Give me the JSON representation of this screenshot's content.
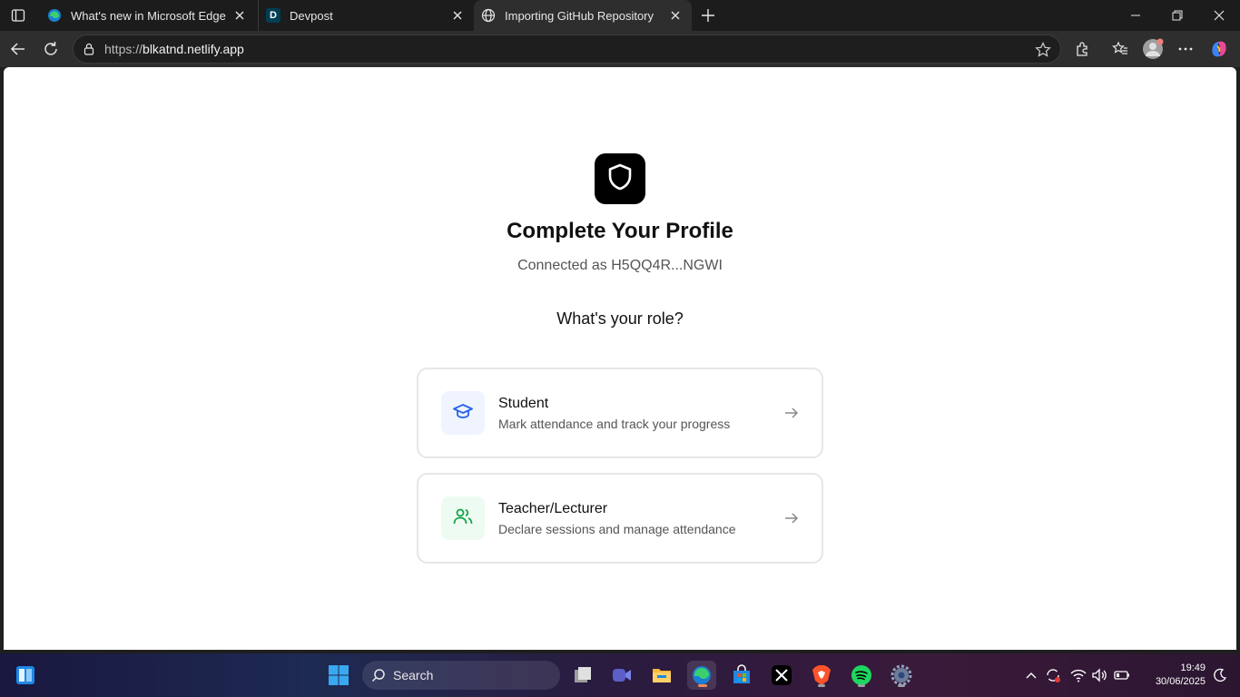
{
  "browser": {
    "tabs": [
      {
        "title": "What's new in Microsoft Edge"
      },
      {
        "title": "Devpost",
        "icon_letter": "D"
      },
      {
        "title": "Importing GitHub Repository"
      }
    ],
    "address": {
      "scheme": "https://",
      "host": "blkatnd.netlify.app"
    }
  },
  "page": {
    "title": "Complete Your Profile",
    "connected_as": "Connected as H5QQ4R...NGWI",
    "role_question": "What's your role?",
    "roles": [
      {
        "title": "Student",
        "description": "Mark attendance and track your progress",
        "icon": "graduation-cap-icon",
        "icon_color": "#2563eb",
        "icon_bg": "#eff4ff"
      },
      {
        "title": "Teacher/Lecturer",
        "description": "Declare sessions and manage attendance",
        "icon": "users-icon",
        "icon_color": "#16a34a",
        "icon_bg": "#eefbf2"
      }
    ]
  },
  "taskbar": {
    "search_label": "Search",
    "time": "19:49",
    "date": "30/06/2025"
  },
  "colors": {
    "accent_black": "#000000",
    "student_accent": "#2563eb",
    "teacher_accent": "#16a34a"
  }
}
